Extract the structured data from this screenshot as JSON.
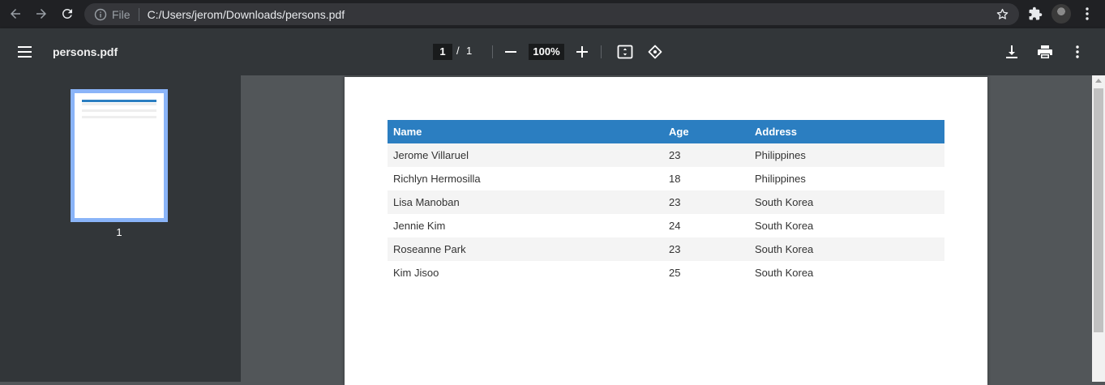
{
  "browser": {
    "file_label": "File",
    "url": "C:/Users/jerom/Downloads/persons.pdf"
  },
  "pdf_toolbar": {
    "title": "persons.pdf",
    "current_page": "1",
    "page_separator": "/",
    "total_pages": "1",
    "zoom": "100%"
  },
  "sidebar": {
    "thumbnail_label": "1"
  },
  "table": {
    "headers": [
      "Name",
      "Age",
      "Address"
    ],
    "rows": [
      [
        "Jerome Villaruel",
        "23",
        "Philippines"
      ],
      [
        "Richlyn Hermosilla",
        "18",
        "Philippines"
      ],
      [
        "Lisa Manoban",
        "23",
        "South Korea"
      ],
      [
        "Jennie Kim",
        "24",
        "South Korea"
      ],
      [
        "Roseanne Park",
        "23",
        "South Korea"
      ],
      [
        "Kim Jisoo",
        "25",
        "South Korea"
      ]
    ]
  },
  "colors": {
    "header_bg": "#2b7ec1",
    "thumbnail_border": "#8ab4f8"
  }
}
